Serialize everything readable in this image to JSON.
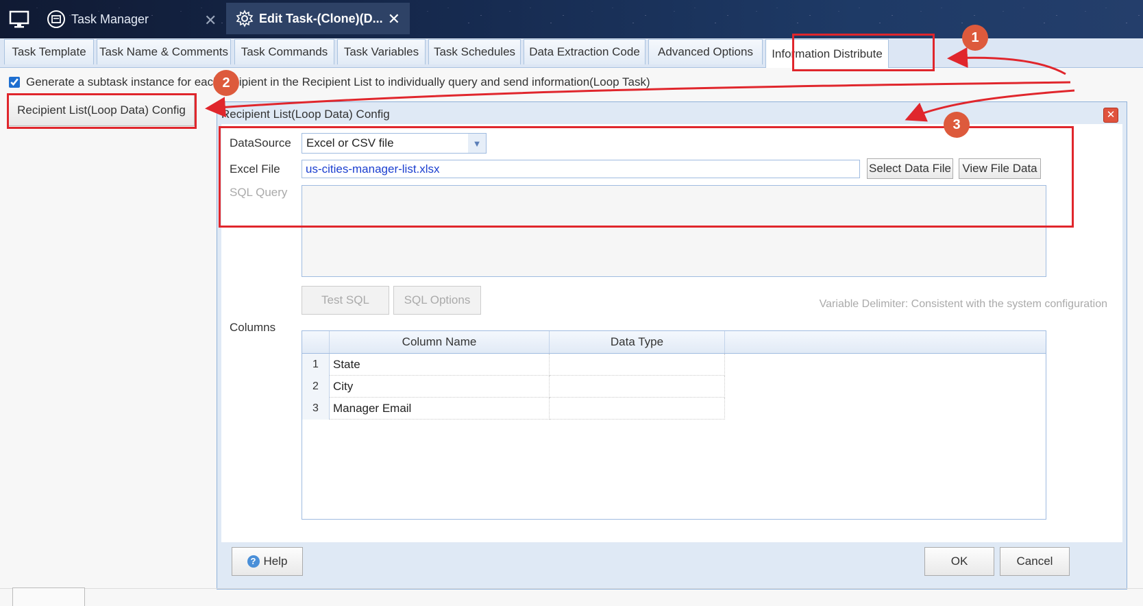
{
  "topbar": {
    "task_manager_tab": "Task Manager",
    "edit_task_tab": "Edit Task-(Clone)(D..."
  },
  "tabs": [
    {
      "label": "Task Template"
    },
    {
      "label": "Task Name & Comments"
    },
    {
      "label": "Task Commands"
    },
    {
      "label": "Task Variables"
    },
    {
      "label": "Task Schedules"
    },
    {
      "label": "Data Extraction Code"
    },
    {
      "label": "Advanced Options"
    },
    {
      "label": "Information Distribute",
      "active": true
    }
  ],
  "generate_subtask": {
    "checked": true,
    "label": "Generate a subtask instance for each recipient in the Recipient List to individually query and send information(Loop Task)"
  },
  "loop_config_button": "Recipient List(Loop Data) Config",
  "dialog": {
    "title": "Recipient List(Loop Data) Config",
    "datasource_label": "DataSource",
    "datasource_value": "Excel or CSV file",
    "excel_file_label": "Excel File",
    "excel_file_value": "us-cities-manager-list.xlsx",
    "select_data_file": "Select Data File",
    "view_file_data": "View File Data",
    "sql_query_label": "SQL Query",
    "test_sql": "Test SQL",
    "sql_options": "SQL Options",
    "variable_delimiter": "Variable Delimiter: Consistent with the system configuration",
    "columns_label": "Columns",
    "grid_headers": {
      "column_name": "Column Name",
      "data_type": "Data Type"
    },
    "columns": [
      {
        "num": "1",
        "name": "State",
        "type": ""
      },
      {
        "num": "2",
        "name": "City",
        "type": ""
      },
      {
        "num": "3",
        "name": "Manager Email",
        "type": ""
      }
    ],
    "help": "Help",
    "ok": "OK",
    "cancel": "Cancel"
  },
  "annotations": {
    "badge1": "1",
    "badge2": "2",
    "badge3": "3"
  },
  "colors": {
    "annotation_red": "#e0262c",
    "badge": "#dd5a3c",
    "link_blue": "#1a3ecf"
  }
}
